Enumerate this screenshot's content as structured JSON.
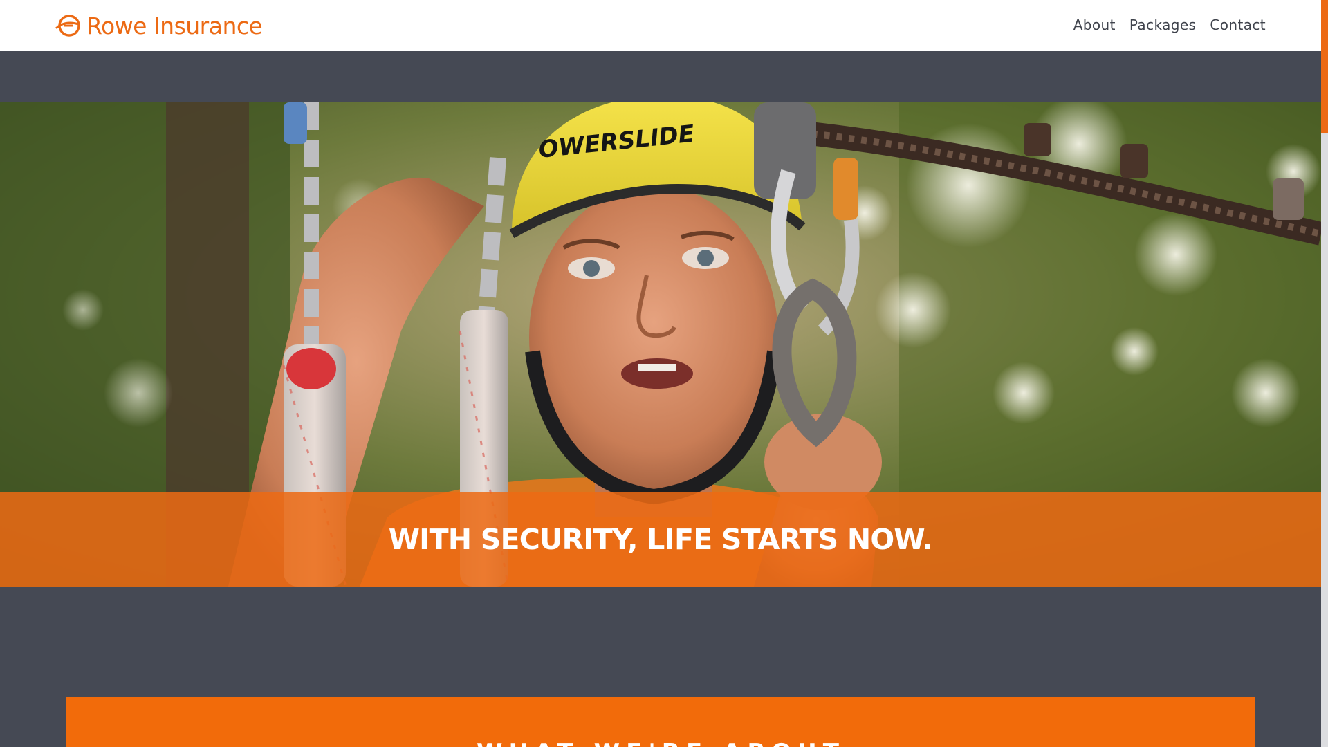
{
  "site": {
    "brand_name": "Rowe Insurance",
    "logo_icon": "rowe-swirl-logo-icon",
    "accent_color": "#ec6a14",
    "background_color": "#454954"
  },
  "nav": {
    "items": [
      {
        "label": "About"
      },
      {
        "label": "Packages"
      },
      {
        "label": "Contact"
      }
    ]
  },
  "hero": {
    "headline": "WITH SECURITY, LIFE STARTS NOW.",
    "helmet_text": "OWERSLIDE"
  },
  "about": {
    "title": "WHAT WE'RE ABOUT"
  }
}
